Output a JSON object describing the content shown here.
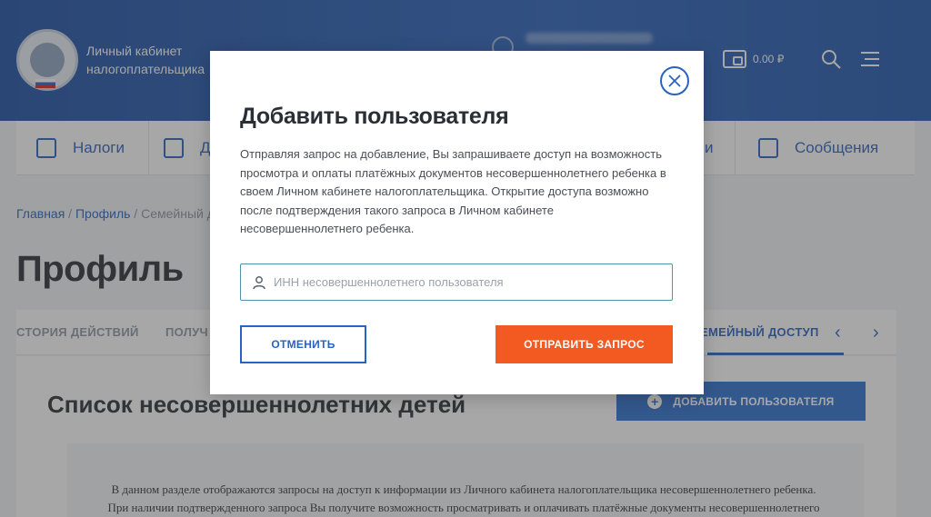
{
  "header": {
    "brand_line1": "Личный кабинет",
    "brand_line2": "налогоплательщика",
    "balance": "0.00 ₽"
  },
  "nav": {
    "items": [
      {
        "label": "Налоги"
      },
      {
        "label": "Д"
      },
      {
        "label": "и"
      },
      {
        "label": "Сообщения"
      }
    ]
  },
  "breadcrumb": {
    "home": "Главная",
    "sep1": " / ",
    "profile": "Профиль",
    "sep2": " / ",
    "current": "Семейный д"
  },
  "page": {
    "title": "Профиль"
  },
  "tabs": {
    "items": [
      {
        "label": "СТОРИЯ ДЕЙСТВИЙ"
      },
      {
        "label": "ПОЛУЧ"
      },
      {
        "label": "ЕМЕЙНЫЙ ДОСТУП"
      }
    ],
    "prev": "‹",
    "next": "›"
  },
  "content": {
    "list_title": "Список несовершеннолетних детей",
    "add_button": "ДОБАВИТЬ ПОЛЬЗОВАТЕЛЯ",
    "add_plus": "+",
    "info_line1": "В данном разделе отображаются запросы на доступ к информации из Личного кабинета налогоплательщика несовершеннолетнего ребенка.",
    "info_line2": "При наличии подтвержденного запроса Вы получите возможность просматривать и оплачивать платёжные документы несовершеннолетнего"
  },
  "modal": {
    "title": "Добавить пользователя",
    "description": "Отправляя запрос на добавление, Вы запрашиваете доступ на возможность просмотра и оплаты платёжных документов несовершеннолетнего ребенка в своем Личном кабинете налогоплательщика. Открытие доступа возможно после подтверждения такого запроса в Личном кабинете несовершеннолетнего ребенка.",
    "inn_placeholder": "ИНН несовершеннолетнего пользователя",
    "inn_value": "",
    "cancel_label": "ОТМЕНИТЬ",
    "send_label": "ОТПРАВИТЬ ЗАПРОС"
  },
  "colors": {
    "header_blue": "#2a63bd",
    "accent_blue": "#2962c4",
    "send_orange": "#f25a22"
  },
  "icons": {
    "logo": "fns-emblem",
    "user": "user-icon",
    "wallet": "wallet-icon",
    "search": "search-icon",
    "menu": "hamburger-icon",
    "close": "close-icon",
    "person": "person-icon"
  }
}
